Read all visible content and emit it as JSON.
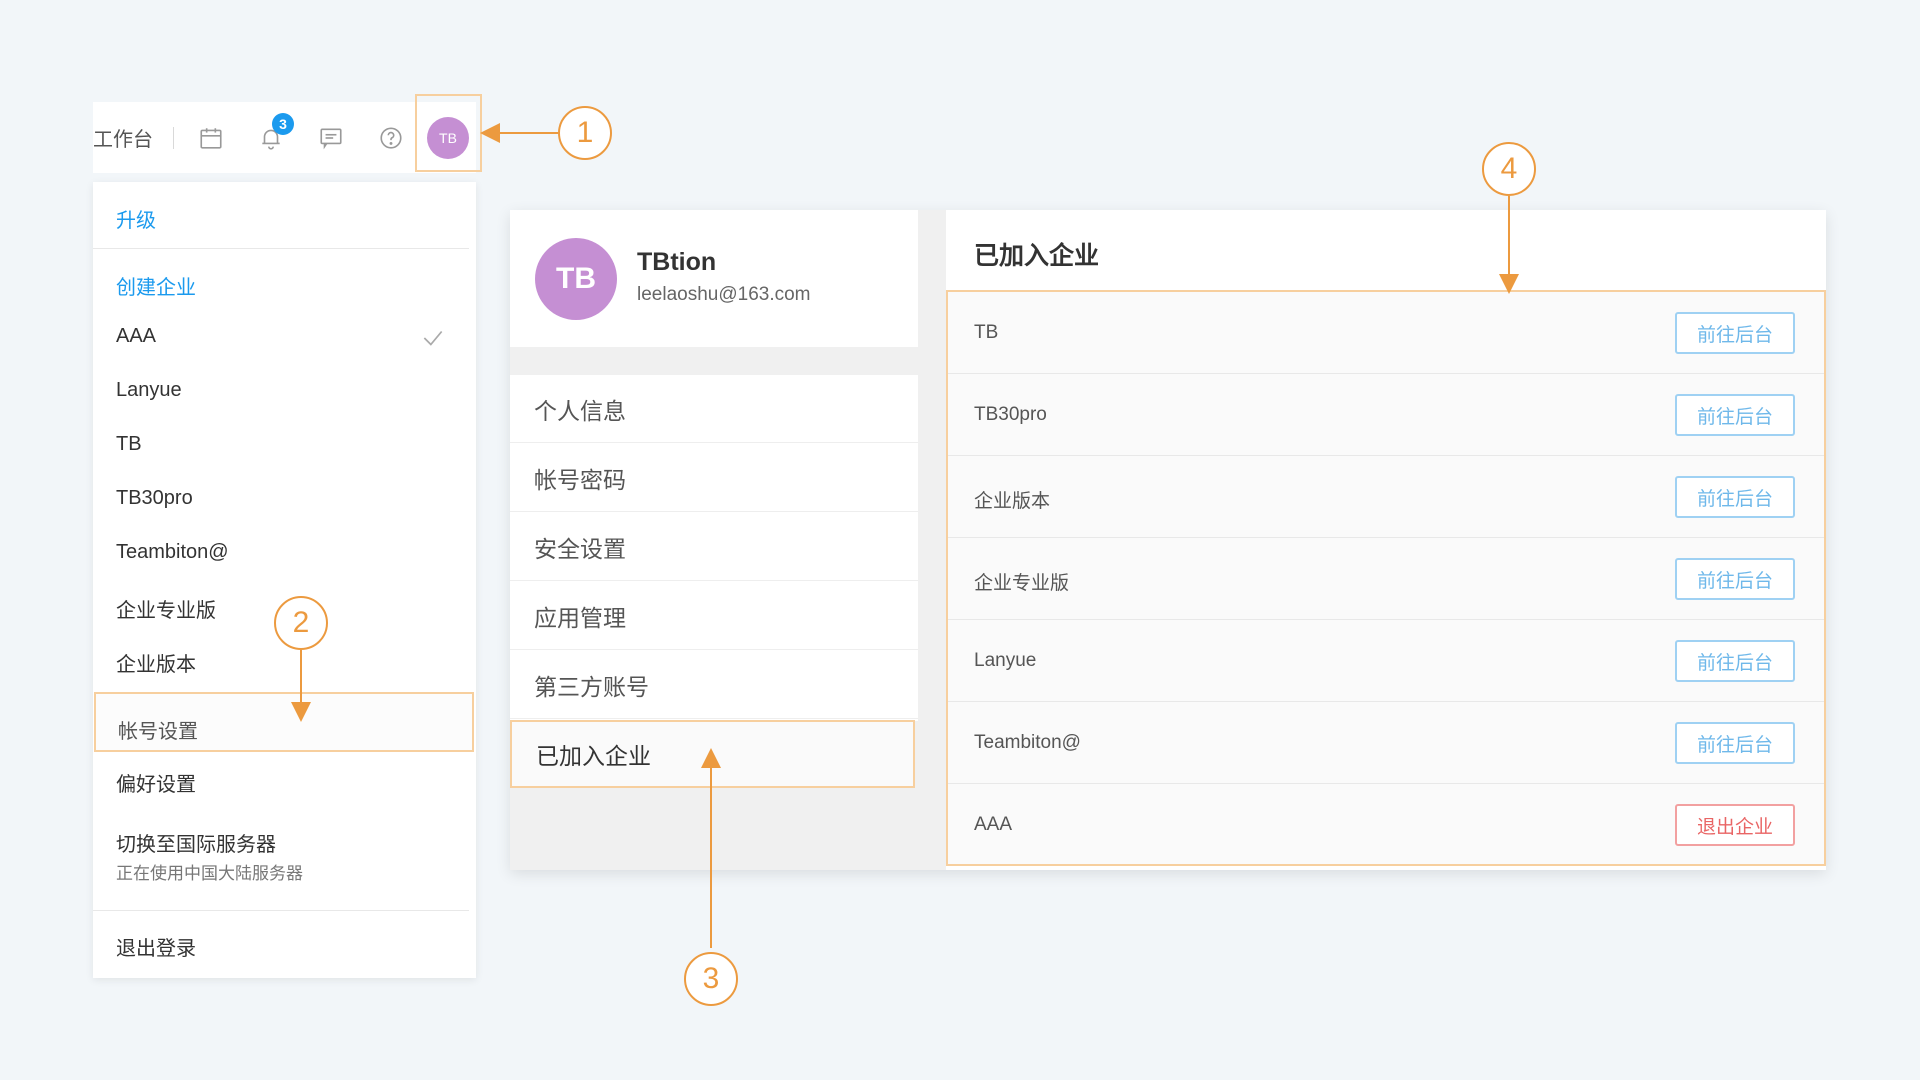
{
  "header": {
    "workbench_label": "工作台",
    "notification_count": "3",
    "avatar_initials": "TB"
  },
  "dropdown": {
    "upgrade": "升级",
    "create_org": "创建企业",
    "orgs": [
      "AAA",
      "Lanyue",
      "TB",
      "TB30pro",
      "Teambiton@",
      "企业专业版",
      "企业版本"
    ],
    "selected_org": "AAA",
    "account_settings": "帐号设置",
    "preferences": "偏好设置",
    "switch_server": "切换至国际服务器",
    "server_status": "正在使用中国大陆服务器",
    "logout": "退出登录"
  },
  "profile": {
    "initials": "TB",
    "name": "TBtion",
    "email": "leelaoshu@163.com"
  },
  "settings_menu": [
    "个人信息",
    "帐号密码",
    "安全设置",
    "应用管理",
    "第三方账号",
    "已加入企业"
  ],
  "content": {
    "title": "已加入企业",
    "rows": [
      {
        "name": "TB",
        "action": "前往后台"
      },
      {
        "name": "TB30pro",
        "action": "前往后台"
      },
      {
        "name": "企业版本",
        "action": "前往后台"
      },
      {
        "name": "企业专业版",
        "action": "前往后台"
      },
      {
        "name": "Lanyue",
        "action": "前往后台"
      },
      {
        "name": "Teambiton@",
        "action": "前往后台"
      },
      {
        "name": "AAA",
        "action": "退出企业"
      }
    ]
  },
  "callouts": [
    "1",
    "2",
    "3",
    "4"
  ],
  "colors": {
    "accent": "#1b9aee",
    "callout": "#ec9a3f",
    "highlight_border": "#f7cf9e",
    "avatar": "#c58fd3",
    "danger": "#e96565"
  }
}
